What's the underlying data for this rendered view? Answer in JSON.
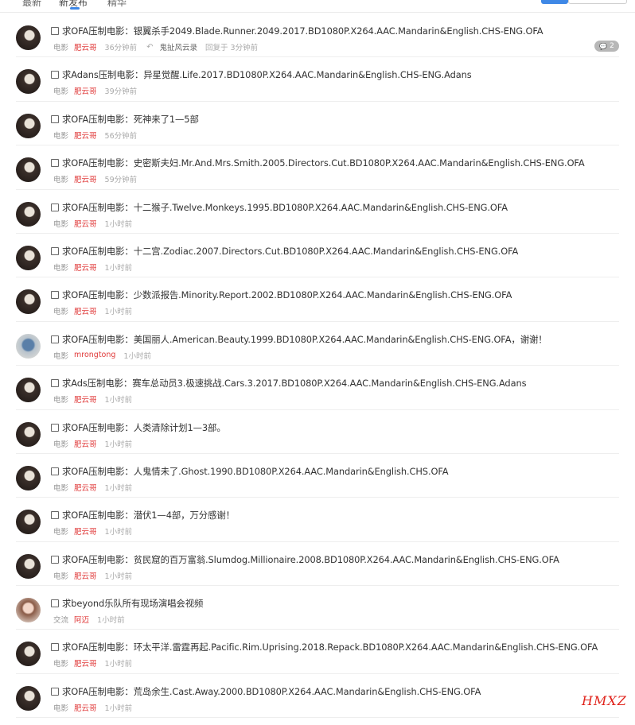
{
  "header": {
    "tabs": [
      "最新",
      "新发布",
      "精华"
    ],
    "active_tab": 1
  },
  "threads": [
    {
      "avatar": "dark",
      "title": "求OFA压制电影：银翼杀手2049.Blade.Runner.2049.2017.BD1080P.X264.AAC.Mandarin&English.CHS-ENG.OFA",
      "category": "电影",
      "author": "肥云哥",
      "time": "36分钟前",
      "reply_user": "鬼扯风云录",
      "reply_time": "回复于 3分钟前",
      "reply_count": "2"
    },
    {
      "avatar": "dark",
      "title": "求Adans压制电影：异星觉醒.Life.2017.BD1080P.X264.AAC.Mandarin&English.CHS-ENG.Adans",
      "category": "电影",
      "author": "肥云哥",
      "time": "39分钟前"
    },
    {
      "avatar": "dark",
      "title": "求OFA压制电影：死神来了1—5部",
      "category": "电影",
      "author": "肥云哥",
      "time": "56分钟前"
    },
    {
      "avatar": "dark",
      "title": "求OFA压制电影：史密斯夫妇.Mr.And.Mrs.Smith.2005.Directors.Cut.BD1080P.X264.AAC.Mandarin&English.CHS-ENG.OFA",
      "category": "电影",
      "author": "肥云哥",
      "time": "59分钟前"
    },
    {
      "avatar": "dark",
      "title": "求OFA压制电影：十二猴子.Twelve.Monkeys.1995.BD1080P.X264.AAC.Mandarin&English.CHS-ENG.OFA",
      "category": "电影",
      "author": "肥云哥",
      "time": "1小时前"
    },
    {
      "avatar": "dark",
      "title": "求OFA压制电影：十二宫.Zodiac.2007.Directors.Cut.BD1080P.X264.AAC.Mandarin&English.CHS-ENG.OFA",
      "category": "电影",
      "author": "肥云哥",
      "time": "1小时前"
    },
    {
      "avatar": "dark",
      "title": "求OFA压制电影：少数派报告.Minority.Report.2002.BD1080P.X264.AAC.Mandarin&English.CHS-ENG.OFA",
      "category": "电影",
      "author": "肥云哥",
      "time": "1小时前"
    },
    {
      "avatar": "light",
      "title": "求OFA压制电影：美国丽人.American.Beauty.1999.BD1080P.X264.AAC.Mandarin&English.CHS-ENG.OFA，谢谢！",
      "category": "电影",
      "author": "mrongtong",
      "time": "1小时前"
    },
    {
      "avatar": "dark",
      "title": "求Ads压制电影：赛车总动员3.极速挑战.Cars.3.2017.BD1080P.X264.AAC.Mandarin&English.CHS-ENG.Adans",
      "category": "电影",
      "author": "肥云哥",
      "time": "1小时前"
    },
    {
      "avatar": "dark",
      "title": "求OFA压制电影：人类清除计划1—3部。",
      "category": "电影",
      "author": "肥云哥",
      "time": "1小时前"
    },
    {
      "avatar": "dark",
      "title": "求OFA压制电影：人鬼情未了.Ghost.1990.BD1080P.X264.AAC.Mandarin&English.CHS.OFA",
      "category": "电影",
      "author": "肥云哥",
      "time": "1小时前"
    },
    {
      "avatar": "dark",
      "title": "求OFA压制电影：潜伏1—4部，万分感谢！",
      "category": "电影",
      "author": "肥云哥",
      "time": "1小时前"
    },
    {
      "avatar": "dark",
      "title": "求OFA压制电影：贫民窟的百万富翁.Slumdog.Millionaire.2008.BD1080P.X264.AAC.Mandarin&English.CHS-ENG.OFA",
      "category": "电影",
      "author": "肥云哥",
      "time": "1小时前"
    },
    {
      "avatar": "girl",
      "title": "求beyond乐队所有现场演唱会视频",
      "category": "交流",
      "author": "阿迈",
      "time": "1小时前"
    },
    {
      "avatar": "dark",
      "title": "求OFA压制电影：环太平洋.雷霆再起.Pacific.Rim.Uprising.2018.Repack.BD1080P.X264.AAC.Mandarin&English.CHS-ENG.OFA",
      "category": "电影",
      "author": "肥云哥",
      "time": "1小时前"
    },
    {
      "avatar": "dark",
      "title": "求OFA压制电影：荒岛余生.Cast.Away.2000.BD1080P.X264.AAC.Mandarin&English.CHS-ENG.OFA",
      "category": "电影",
      "author": "肥云哥",
      "time": "1小时前"
    }
  ],
  "watermark": "HMXZ",
  "colors": {
    "author": "#e03a3a",
    "accent": "#3f88e6",
    "watermark": "#e0231b"
  }
}
